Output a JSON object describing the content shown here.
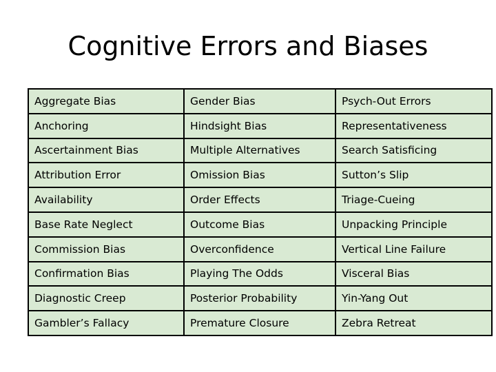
{
  "slide": {
    "title": "Cognitive Errors and Biases",
    "background_color": "#ffffff",
    "cell_fill_color": "#d9ead3",
    "border_color": "#000000",
    "text_color": "#000000"
  },
  "table": {
    "columns": 3,
    "rows": 10,
    "cells": [
      [
        "Aggregate Bias",
        "Gender Bias",
        "Psych-Out Errors"
      ],
      [
        "Anchoring",
        "Hindsight Bias",
        "Representativeness"
      ],
      [
        "Ascertainment Bias",
        "Multiple Alternatives",
        "Search Satisficing"
      ],
      [
        "Attribution Error",
        "Omission Bias",
        "Sutton’s Slip"
      ],
      [
        "Availability",
        "Order Effects",
        "Triage-Cueing"
      ],
      [
        "Base Rate Neglect",
        "Outcome Bias",
        "Unpacking Principle"
      ],
      [
        "Commission Bias",
        "Overconfidence",
        "Vertical Line Failure"
      ],
      [
        "Confirmation Bias",
        "Playing The Odds",
        "Visceral Bias"
      ],
      [
        "Diagnostic Creep",
        "Posterior Probability",
        "Yin-Yang Out"
      ],
      [
        "Gambler’s Fallacy",
        "Premature Closure",
        "Zebra Retreat"
      ]
    ]
  }
}
